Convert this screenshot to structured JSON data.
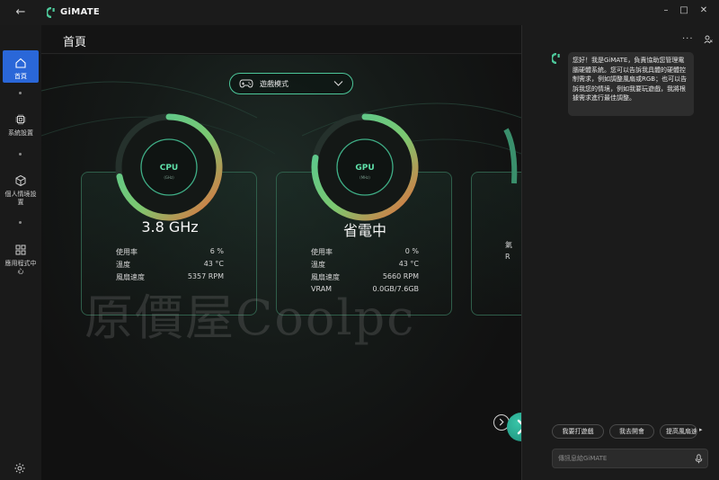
{
  "app": {
    "title": "GiMATE",
    "back_glyph": "←",
    "window_controls": {
      "minimize": "–",
      "maximize": "□",
      "close": "✕"
    },
    "accent": "#2a67d8",
    "brand_green": "#4dc79a",
    "gauge_warm": "#e86a3a"
  },
  "sidenav": {
    "items": [
      {
        "label": "首頁",
        "icon": "home-icon",
        "active": true
      },
      {
        "label": "系統設置",
        "icon": "chip-icon",
        "active": false
      },
      {
        "label": "個人情境設置",
        "icon": "cube-icon",
        "active": false
      },
      {
        "label": "應用程式中心",
        "icon": "grid-icon",
        "active": false
      }
    ],
    "footer_icon": "gear-icon"
  },
  "main": {
    "page_title": "首頁",
    "mode_select": {
      "value": "遊戲模式",
      "icon": "gamepad-icon"
    },
    "cards": [
      {
        "id": "cpu",
        "gauge_label": "CPU",
        "gauge_unit": "(GHz)",
        "gauge_level": 0.72,
        "value": "3.8 GHz",
        "stats": [
          {
            "label": "使用率",
            "value": "6 %"
          },
          {
            "label": "溫度",
            "value": "43 °C"
          },
          {
            "label": "風扇速度",
            "value": "5357 RPM"
          }
        ]
      },
      {
        "id": "gpu",
        "gauge_label": "GPU",
        "gauge_unit": "(MHz)",
        "gauge_level": 0.78,
        "value": "省電中",
        "stats": [
          {
            "label": "使用率",
            "value": "0 %"
          },
          {
            "label": "溫度",
            "value": "43 °C"
          },
          {
            "label": "風扇速度",
            "value": "5660 RPM"
          },
          {
            "label": "VRAM",
            "value": "0.0GB/7.6GB"
          }
        ]
      }
    ],
    "partial_card_text": [
      "氣",
      "R"
    ],
    "watermark": "原價屋Coolpc"
  },
  "chat": {
    "menu_glyph": "···",
    "bot_message": "您好！我是GiMATE，負責協助您管理電腦硬體系統。您可以告訴我具體的硬體控制需求，例如調整風扇或RGB；也可以告訴我您的情境，例如我要玩遊戲，我將根據需求進行最佳調整。",
    "suggestions": [
      "我要打遊戲",
      "我去開會",
      "提高風扇速度"
    ],
    "more_arrow": "▸",
    "input_placeholder": "傳訊息給GiMATE"
  }
}
